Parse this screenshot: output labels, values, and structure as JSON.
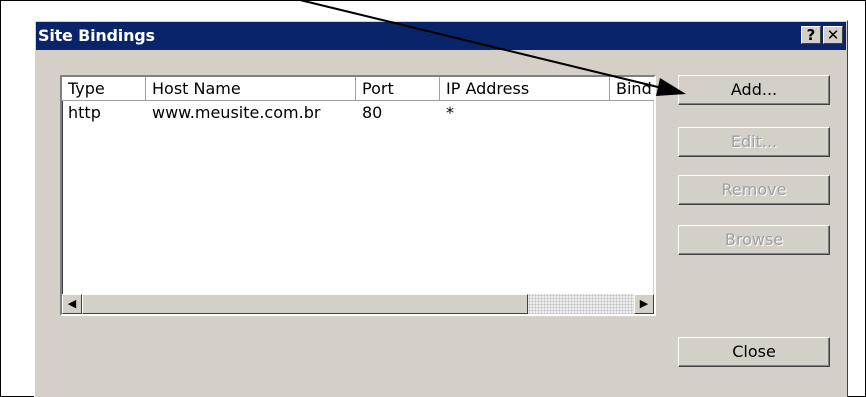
{
  "dialog": {
    "title": "Site Bindings",
    "help_label": "?",
    "close_label": "✕"
  },
  "list": {
    "columns": [
      "Type",
      "Host Name",
      "Port",
      "IP Address",
      "Bind"
    ],
    "rows": [
      [
        "http",
        "www.meusite.com.br",
        "80",
        "*"
      ]
    ]
  },
  "buttons": {
    "add": "Add...",
    "edit": "Edit...",
    "remove": "Remove",
    "browse": "Browse",
    "close": "Close"
  },
  "scrollbar": {
    "left_arrow": "◀",
    "right_arrow": "▶"
  },
  "icons": [
    "help-icon",
    "close-icon",
    "scroll-left-icon",
    "scroll-right-icon",
    "annotation-arrow"
  ]
}
